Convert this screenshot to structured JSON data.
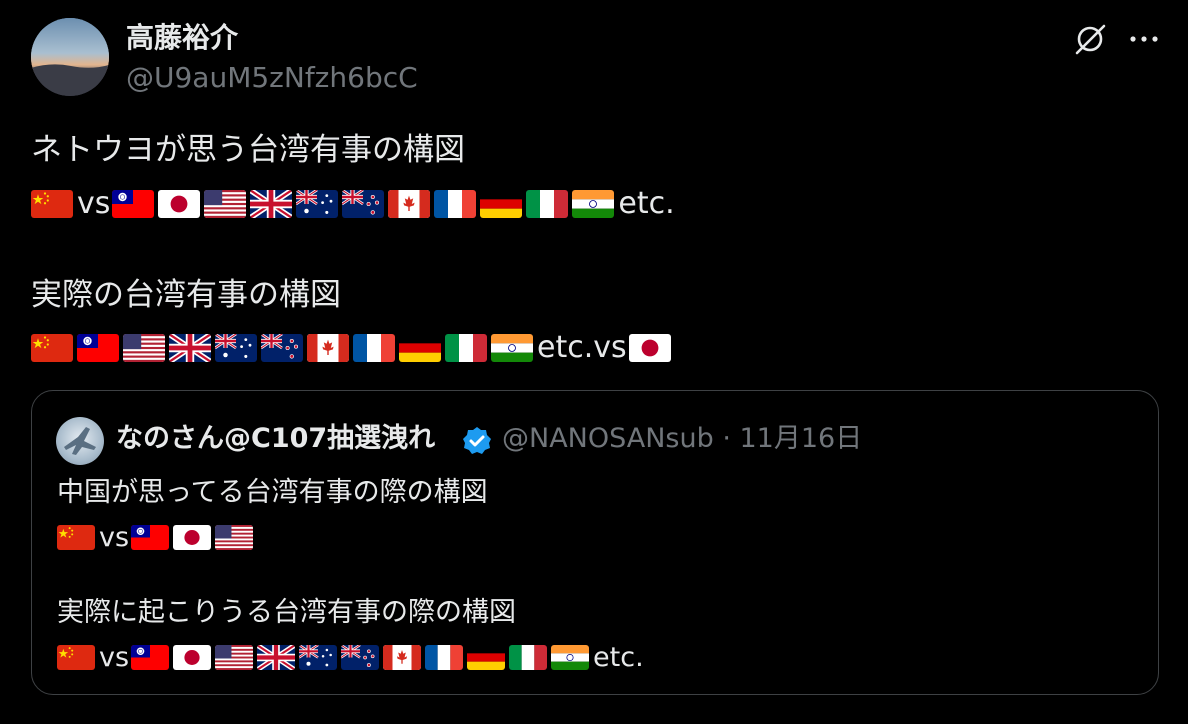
{
  "author": {
    "display_name": "高藤裕介",
    "handle": "@U9auM5zNfzh6bcC"
  },
  "post": {
    "line1": "ネトウヨが思う台湾有事の構図",
    "row1": [
      "cn",
      "txt:vs",
      "tw",
      "jp",
      "us",
      "gb",
      "au",
      "nz",
      "ca",
      "fr",
      "de",
      "it",
      "in",
      "txt:etc."
    ],
    "line2": "実際の台湾有事の構図",
    "row2": [
      "cn",
      "tw",
      "us",
      "gb",
      "au",
      "nz",
      "ca",
      "fr",
      "de",
      "it",
      "in",
      "txt:etc.vs",
      "jp"
    ]
  },
  "quote": {
    "display_name": "なのさん@C107抽選洩れ",
    "handle_date": "@NANOSANsub · 11月16日",
    "line1": "中国が思ってる台湾有事の際の構図",
    "row1": [
      "cn",
      "txt:vs",
      "tw",
      "jp",
      "us"
    ],
    "line2": "実際に起こりうる台湾有事の際の構図",
    "row2": [
      "cn",
      "txt:vs",
      "tw",
      "jp",
      "us",
      "gb",
      "au",
      "nz",
      "ca",
      "fr",
      "de",
      "it",
      "in",
      "txt:etc."
    ]
  },
  "icons": {
    "grok": "grok-icon",
    "more": "more-icon",
    "verified": "verified-badge-icon"
  },
  "colors": {
    "background": "#000000",
    "text": "#e7e9ea",
    "muted": "#71767b",
    "border": "#3e4144",
    "verified": "#1d9bf0"
  }
}
